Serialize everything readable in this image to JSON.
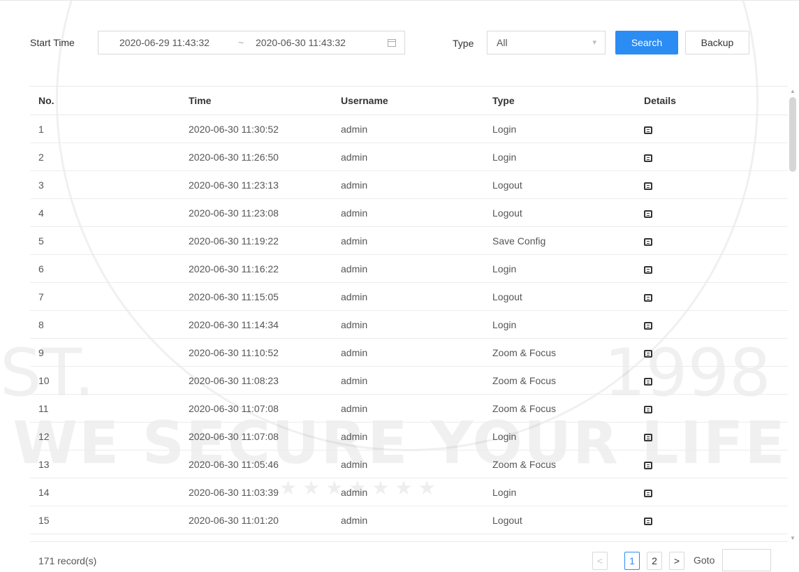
{
  "filter": {
    "start_time_label": "Start Time",
    "start_time": "2020-06-29 11:43:32",
    "separator": "~",
    "end_time": "2020-06-30 11:43:32",
    "type_label": "Type",
    "type_value": "All",
    "search_label": "Search",
    "backup_label": "Backup"
  },
  "table": {
    "headers": [
      "No.",
      "Time",
      "Username",
      "Type",
      "Details"
    ],
    "rows": [
      {
        "no": "1",
        "time": "2020-06-30 11:30:52",
        "user": "admin",
        "type": "Login"
      },
      {
        "no": "2",
        "time": "2020-06-30 11:26:50",
        "user": "admin",
        "type": "Login"
      },
      {
        "no": "3",
        "time": "2020-06-30 11:23:13",
        "user": "admin",
        "type": "Logout"
      },
      {
        "no": "4",
        "time": "2020-06-30 11:23:08",
        "user": "admin",
        "type": "Logout"
      },
      {
        "no": "5",
        "time": "2020-06-30 11:19:22",
        "user": "admin",
        "type": "Save Config"
      },
      {
        "no": "6",
        "time": "2020-06-30 11:16:22",
        "user": "admin",
        "type": "Login"
      },
      {
        "no": "7",
        "time": "2020-06-30 11:15:05",
        "user": "admin",
        "type": "Logout"
      },
      {
        "no": "8",
        "time": "2020-06-30 11:14:34",
        "user": "admin",
        "type": "Login"
      },
      {
        "no": "9",
        "time": "2020-06-30 11:10:52",
        "user": "admin",
        "type": "Zoom & Focus"
      },
      {
        "no": "10",
        "time": "2020-06-30 11:08:23",
        "user": "admin",
        "type": "Zoom & Focus"
      },
      {
        "no": "11",
        "time": "2020-06-30 11:07:08",
        "user": "admin",
        "type": "Zoom & Focus"
      },
      {
        "no": "12",
        "time": "2020-06-30 11:07:08",
        "user": "admin",
        "type": "Login"
      },
      {
        "no": "13",
        "time": "2020-06-30 11:05:46",
        "user": "admin",
        "type": "Zoom & Focus"
      },
      {
        "no": "14",
        "time": "2020-06-30 11:03:39",
        "user": "admin",
        "type": "Login"
      },
      {
        "no": "15",
        "time": "2020-06-30 11:01:20",
        "user": "admin",
        "type": "Logout"
      }
    ],
    "details_icon": "document-icon"
  },
  "footer": {
    "records": "171 record(s)",
    "pages": [
      "1",
      "2"
    ],
    "current_page": "1",
    "prev_icon": "<",
    "next_icon": ">",
    "goto_label": "Goto",
    "goto_value": ""
  },
  "watermark": {
    "slogan": "WE SECURE YOUR LIFE",
    "est": "ST.",
    "year": "1998"
  },
  "colors": {
    "accent": "#2b8cf4",
    "border": "#d9d9d9",
    "text": "#333333"
  }
}
